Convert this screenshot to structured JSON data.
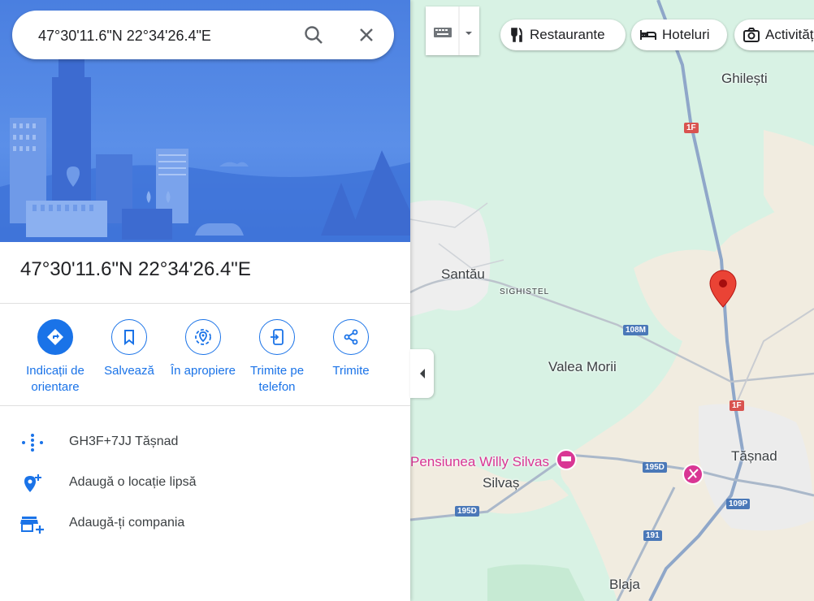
{
  "search": {
    "value": "47°30'11.6\"N 22°34'26.4\"E"
  },
  "place": {
    "title": "47°30'11.6\"N 22°34'26.4\"E"
  },
  "actions": [
    {
      "label": "Indicații de orientare",
      "icon": "directions-icon"
    },
    {
      "label": "Salvează",
      "icon": "bookmark-icon"
    },
    {
      "label": "În apropiere",
      "icon": "nearby-icon"
    },
    {
      "label": "Trimite pe telefon",
      "icon": "send-to-phone-icon"
    },
    {
      "label": "Trimite",
      "icon": "share-icon"
    }
  ],
  "info": {
    "plus_code": "GH3F+7JJ Tășnad",
    "add_location": "Adaugă o locație lipsă",
    "add_business": "Adaugă-ți compania"
  },
  "chips": {
    "restaurants": "Restaurante",
    "hotels": "Hoteluri",
    "activities": "Activități"
  },
  "map": {
    "places": {
      "ghilesti": "Ghilești",
      "santau": "Santău",
      "sighistel": "SIGHISTEL",
      "valea_morii": "Valea Morii",
      "tasnad": "Tășnad",
      "silvas": "Silvaș",
      "blaja": "Blaja",
      "pensiune": "Pensiunea Willy Silvas"
    },
    "roads": {
      "r1f_top": "1F",
      "r1f_mid": "1F",
      "r108m": "108M",
      "r195d_a": "195D",
      "r195d_b": "195D",
      "r109p": "109P",
      "r191": "191"
    }
  },
  "colors": {
    "accent": "#1a73e8",
    "pin": "#ea4335",
    "pink": "#d93694"
  }
}
